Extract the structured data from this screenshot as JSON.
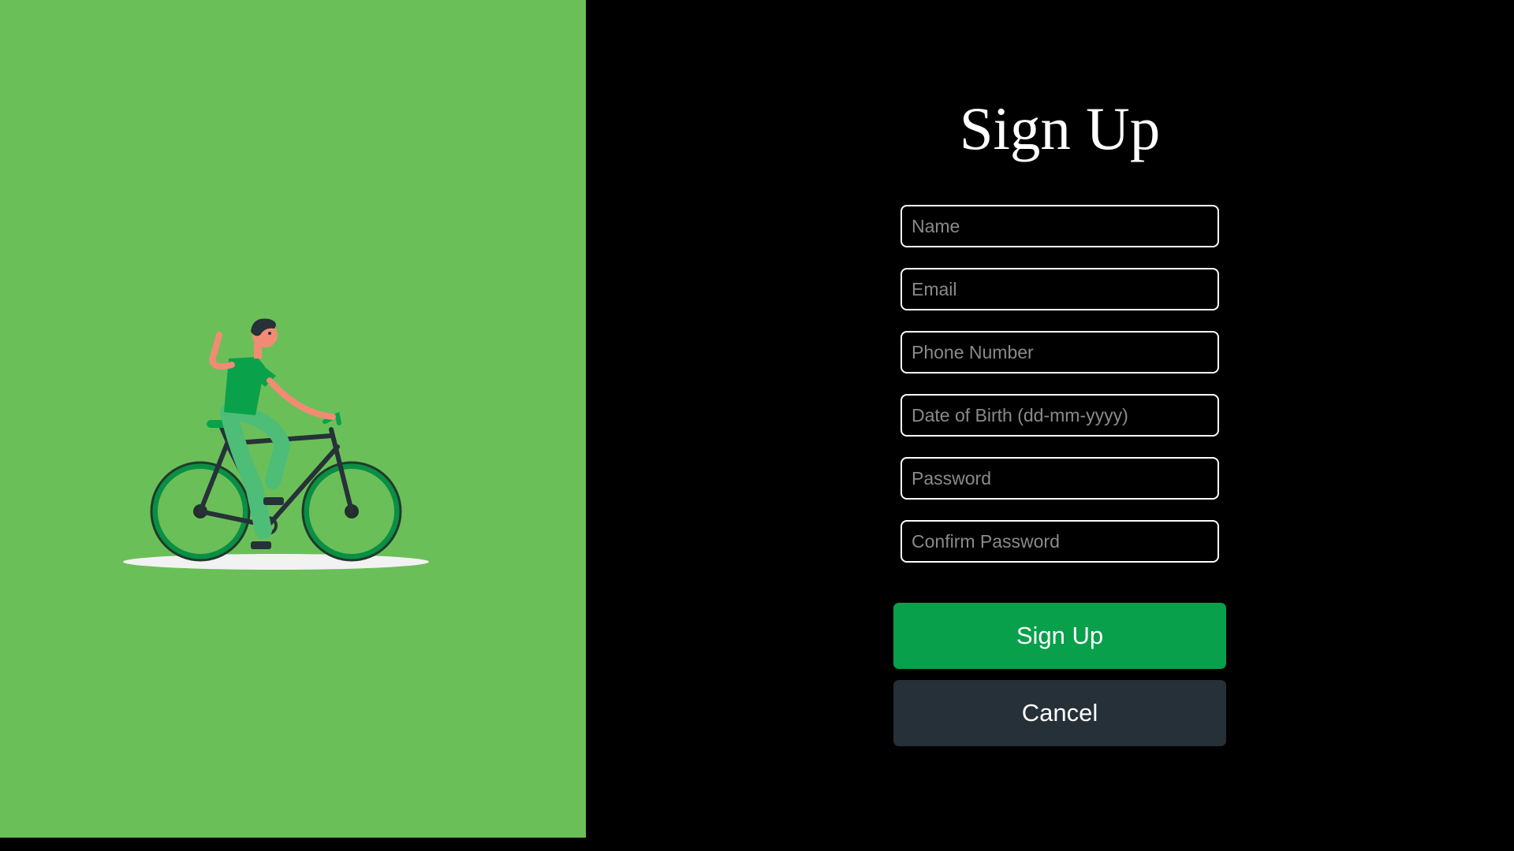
{
  "form": {
    "title": "Sign Up",
    "fields": [
      {
        "placeholder": "Name",
        "value": ""
      },
      {
        "placeholder": "Email",
        "value": ""
      },
      {
        "placeholder": "Phone Number",
        "value": ""
      },
      {
        "placeholder": "Date of Birth (dd-mm-yyyy)",
        "value": ""
      },
      {
        "placeholder": "Password",
        "value": ""
      },
      {
        "placeholder": "Confirm Password",
        "value": ""
      }
    ],
    "submit_label": "Sign Up",
    "cancel_label": "Cancel"
  },
  "colors": {
    "panel_green": "#6bbf59",
    "primary_button": "#08a04b",
    "secondary_button": "#263038",
    "background": "#000000"
  },
  "illustration": {
    "icon": "cyclist-illustration"
  }
}
